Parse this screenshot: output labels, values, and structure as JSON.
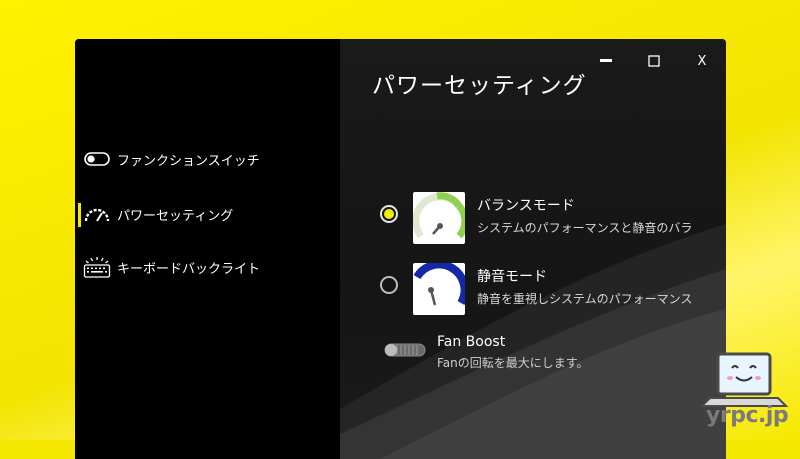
{
  "window": {
    "controls": {
      "minimize": "▬",
      "maximize": "☐",
      "close": "X"
    }
  },
  "sidebar": {
    "items": [
      {
        "label": "ファンクションスイッチ",
        "icon": "toggle-switch-icon"
      },
      {
        "label": "パワーセッティング",
        "icon": "speedometer-icon",
        "active": true
      },
      {
        "label": "キーボードバックライト",
        "icon": "keyboard-backlight-icon"
      }
    ]
  },
  "main": {
    "title": "パワーセッティング",
    "modes": [
      {
        "name": "バランスモード",
        "desc": "システムのパフォーマンスと静音のバランス",
        "selected": true,
        "icon": "balance-gauge-icon",
        "color": "#8fd14f"
      },
      {
        "name": "静音モード",
        "desc": "静音を重視しシステムのパフォーマンス",
        "selected": false,
        "icon": "silent-gauge-icon",
        "color": "#1428a8"
      }
    ],
    "fan_boost": {
      "name": "Fan Boost",
      "desc": "Fanの回転を最大にします。",
      "enabled": false
    }
  },
  "watermark": {
    "text": "yrpc.jp"
  },
  "colors": {
    "accent": "#f5e800",
    "background": "#0b0b0b"
  }
}
